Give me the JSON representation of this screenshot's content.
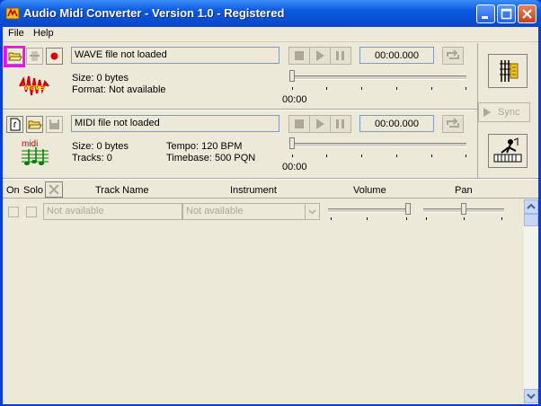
{
  "window": {
    "title": "Audio Midi Converter - Version 1.0 - Registered"
  },
  "menu": {
    "file": "File",
    "help": "Help"
  },
  "wave": {
    "status": "WAVE file not loaded",
    "size": "Size: 0 bytes",
    "format": "Format: Not available",
    "time": "00:00.000",
    "position": "00:00",
    "icon_label": "wave"
  },
  "midi": {
    "status": "MIDI file not loaded",
    "size": "Size: 0 bytes",
    "tracks": "Tracks: 0",
    "tempo": "Tempo: 120 BPM",
    "timebase": "Timebase: 500 PQN",
    "time": "00:00.000",
    "position": "00:00",
    "icon_label": "midi"
  },
  "sync": {
    "label": "Sync"
  },
  "columns": {
    "on": "On",
    "solo": "Solo",
    "track_name": "Track Name",
    "instrument": "Instrument",
    "volume": "Volume",
    "pan": "Pan"
  },
  "row": {
    "track_name": "Not available",
    "instrument": "Not available"
  },
  "colors": {
    "highlight": "#ff00ff",
    "record": "#e00000",
    "title_bar": "#0b5ae0"
  }
}
